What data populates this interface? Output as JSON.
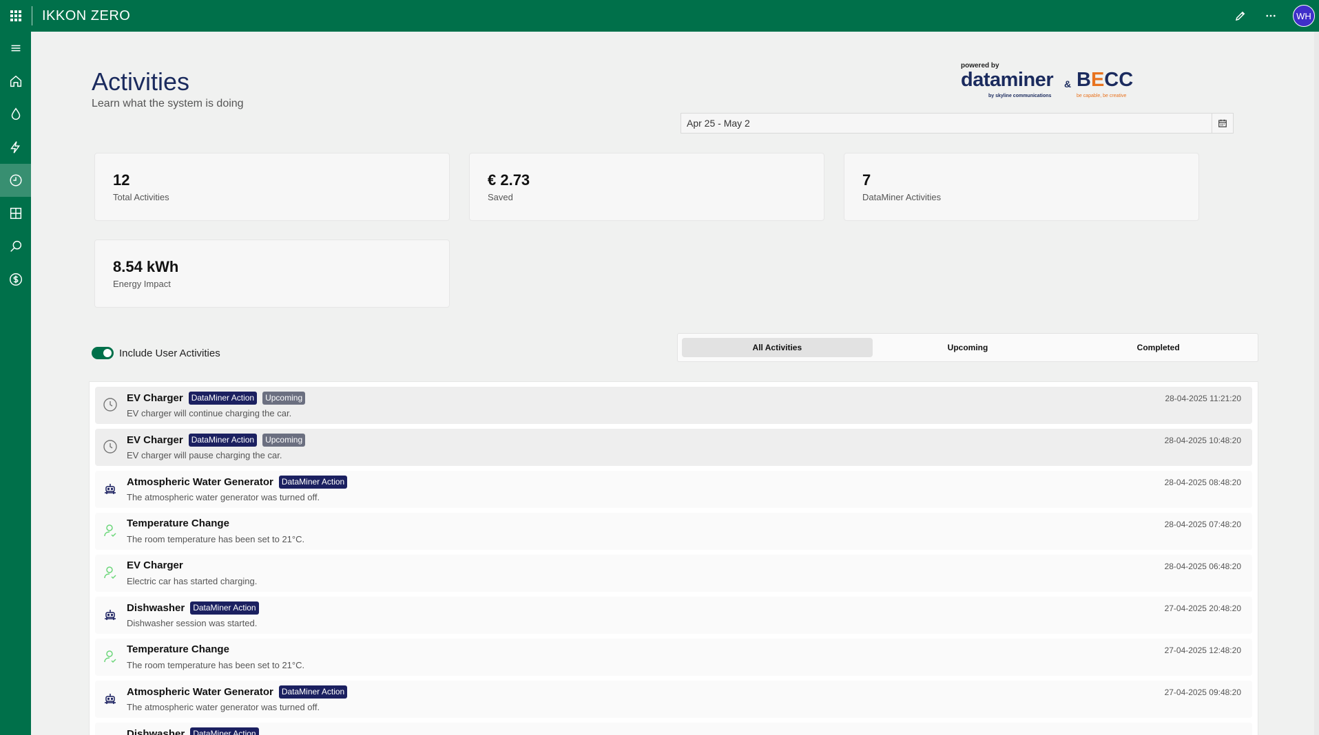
{
  "app": {
    "title": "IKKON ZERO",
    "avatar_initials": "WH",
    "accent": "#00704a"
  },
  "header": {
    "title": "Activities",
    "subtitle": "Learn what the system is doing",
    "logo": {
      "powered_by": "powered by",
      "brand1": "dataminer",
      "brand1_sub": "by skyline communications",
      "amp": "&",
      "brand2_b": "B",
      "brand2_e": "E",
      "brand2_rest": "CC",
      "brand2_sub": "be capable, be creative"
    }
  },
  "date_range": {
    "value": "Apr 25 - May 2"
  },
  "sidebar": {
    "items": [
      {
        "name": "menu-icon"
      },
      {
        "name": "home-icon"
      },
      {
        "name": "water-drop-icon"
      },
      {
        "name": "lightning-icon"
      },
      {
        "name": "clock-icon",
        "active": true
      },
      {
        "name": "grid-icon"
      },
      {
        "name": "search-icon"
      },
      {
        "name": "currency-icon"
      }
    ]
  },
  "kpis": {
    "total": {
      "value": "12",
      "label": "Total Activities"
    },
    "saved": {
      "value": "€ 2.73",
      "label": "Saved"
    },
    "dataminer": {
      "value": "7",
      "label": "DataMiner Activities"
    },
    "energy": {
      "value": "8.54 kWh",
      "label": "Energy Impact"
    }
  },
  "filters": {
    "include_user": {
      "label": "Include User Activities",
      "checked": true
    },
    "tabs": [
      {
        "label": "All Activities",
        "active": true
      },
      {
        "label": "Upcoming"
      },
      {
        "label": "Completed"
      }
    ]
  },
  "activities": [
    {
      "title": "EV Charger",
      "badges": [
        "DataMiner Action",
        "Upcoming"
      ],
      "desc": "EV charger will continue charging the car.",
      "time": "28-04-2025 11:21:20",
      "icon": "clock-icon",
      "upcoming": true
    },
    {
      "title": "EV Charger",
      "badges": [
        "DataMiner Action",
        "Upcoming"
      ],
      "desc": "EV charger will pause charging the car.",
      "time": "28-04-2025 10:48:20",
      "icon": "clock-icon",
      "upcoming": true
    },
    {
      "title": "Atmospheric Water Generator",
      "badges": [
        "DataMiner Action"
      ],
      "desc": "The atmospheric water generator was turned off.",
      "time": "28-04-2025 08:48:20",
      "icon": "robot-icon"
    },
    {
      "title": "Temperature Change",
      "badges": [],
      "desc": "The room temperature has been set to 21°C.",
      "time": "28-04-2025 07:48:20",
      "icon": "user-check-icon"
    },
    {
      "title": "EV Charger",
      "badges": [],
      "desc": "Electric car has started charging.",
      "time": "28-04-2025 06:48:20",
      "icon": "user-check-icon"
    },
    {
      "title": "Dishwasher",
      "badges": [
        "DataMiner Action"
      ],
      "desc": "Dishwasher session was started.",
      "time": "27-04-2025 20:48:20",
      "icon": "robot-icon"
    },
    {
      "title": "Temperature Change",
      "badges": [],
      "desc": "The room temperature has been set to 21°C.",
      "time": "27-04-2025 12:48:20",
      "icon": "user-check-icon"
    },
    {
      "title": "Atmospheric Water Generator",
      "badges": [
        "DataMiner Action"
      ],
      "desc": "The atmospheric water generator was turned off.",
      "time": "27-04-2025 09:48:20",
      "icon": "robot-icon"
    },
    {
      "title": "Dishwasher",
      "badges": [
        "DataMiner Action"
      ],
      "desc": "",
      "time": "",
      "icon": "robot-icon"
    }
  ]
}
